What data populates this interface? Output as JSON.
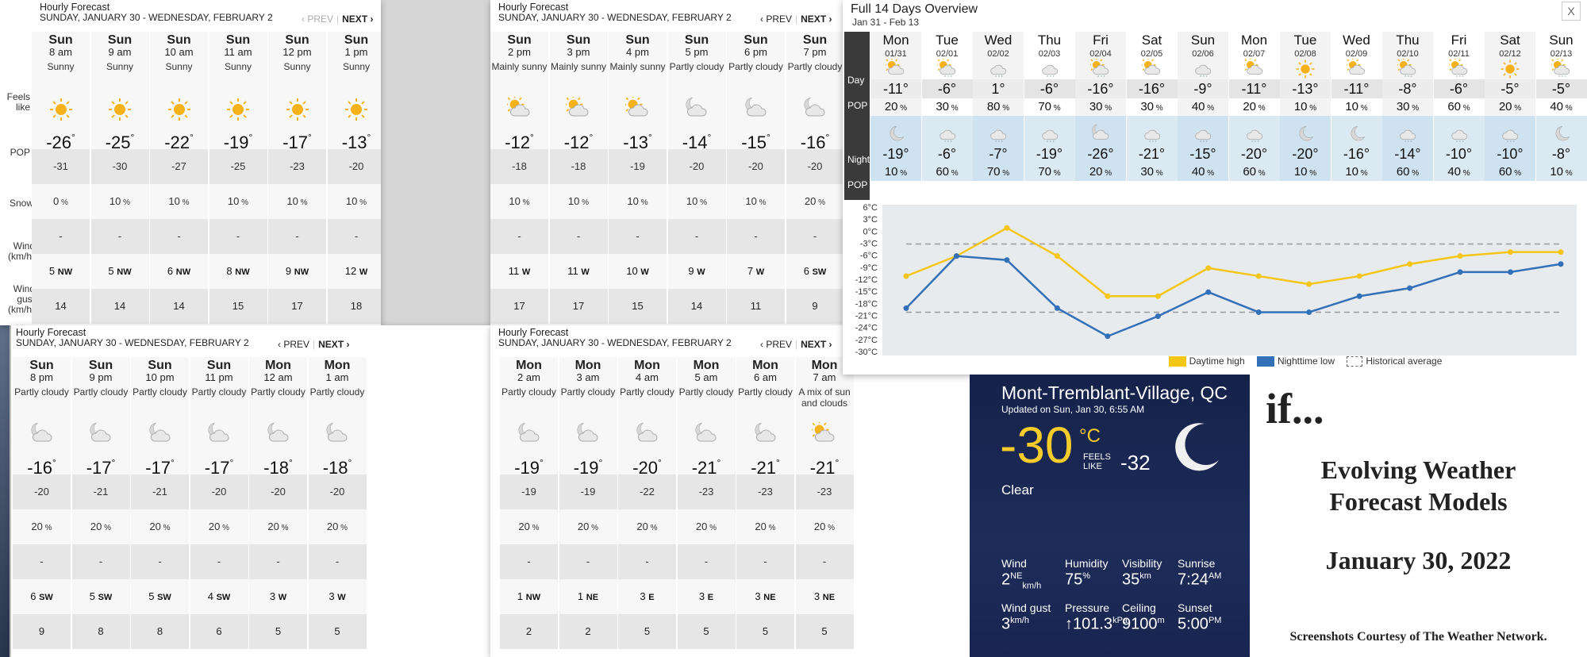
{
  "panels": [
    {
      "heading": "Hourly Forecast",
      "daterange": "SUNDAY, JANUARY 30 - WEDNESDAY, FEBRUARY 2",
      "prev": "‹ PREV",
      "next": "NEXT ›",
      "prev_active": false,
      "row_labels": {
        "feels": "Feels like",
        "pop": "POP",
        "snow": "Snow",
        "wind": "Wind (km/h)",
        "gust": "Wind gust (km/h)"
      },
      "hours": [
        {
          "day": "Sun",
          "time": "8 am",
          "cond": "Sunny",
          "icon": "sun",
          "temp": "-26",
          "feels": "-31",
          "pop": "0",
          "snow": "-",
          "wind": "5",
          "dir": "NW",
          "gust": "14"
        },
        {
          "day": "Sun",
          "time": "9 am",
          "cond": "Sunny",
          "icon": "sun",
          "temp": "-25",
          "feels": "-30",
          "pop": "10",
          "snow": "-",
          "wind": "5",
          "dir": "NW",
          "gust": "14"
        },
        {
          "day": "Sun",
          "time": "10 am",
          "cond": "Sunny",
          "icon": "sun",
          "temp": "-22",
          "feels": "-27",
          "pop": "10",
          "snow": "-",
          "wind": "6",
          "dir": "NW",
          "gust": "14"
        },
        {
          "day": "Sun",
          "time": "11 am",
          "cond": "Sunny",
          "icon": "sun",
          "temp": "-19",
          "feels": "-25",
          "pop": "10",
          "snow": "-",
          "wind": "8",
          "dir": "NW",
          "gust": "15"
        },
        {
          "day": "Sun",
          "time": "12 pm",
          "cond": "Sunny",
          "icon": "sun",
          "temp": "-17",
          "feels": "-23",
          "pop": "10",
          "snow": "-",
          "wind": "9",
          "dir": "NW",
          "gust": "17"
        },
        {
          "day": "Sun",
          "time": "1 pm",
          "cond": "Sunny",
          "icon": "sun",
          "temp": "-13",
          "feels": "-20",
          "pop": "10",
          "snow": "-",
          "wind": "12",
          "dir": "W",
          "gust": "18"
        }
      ]
    },
    {
      "heading": "Hourly Forecast",
      "daterange": "SUNDAY, JANUARY 30 - WEDNESDAY, FEBRUARY 2",
      "prev": "‹ PREV",
      "next": "NEXT ›",
      "prev_active": true,
      "hours": [
        {
          "day": "Sun",
          "time": "2 pm",
          "cond": "Mainly sunny",
          "icon": "sun-cloud",
          "temp": "-12",
          "feels": "-18",
          "pop": "10",
          "snow": "-",
          "wind": "11",
          "dir": "W",
          "gust": "17"
        },
        {
          "day": "Sun",
          "time": "3 pm",
          "cond": "Mainly sunny",
          "icon": "sun-cloud",
          "temp": "-12",
          "feels": "-18",
          "pop": "10",
          "snow": "-",
          "wind": "11",
          "dir": "W",
          "gust": "17"
        },
        {
          "day": "Sun",
          "time": "4 pm",
          "cond": "Mainly sunny",
          "icon": "sun-cloud",
          "temp": "-13",
          "feels": "-19",
          "pop": "10",
          "snow": "-",
          "wind": "10",
          "dir": "W",
          "gust": "15"
        },
        {
          "day": "Sun",
          "time": "5 pm",
          "cond": "Partly cloudy",
          "icon": "moon-cloud",
          "temp": "-14",
          "feels": "-20",
          "pop": "10",
          "snow": "-",
          "wind": "9",
          "dir": "W",
          "gust": "14"
        },
        {
          "day": "Sun",
          "time": "6 pm",
          "cond": "Partly cloudy",
          "icon": "moon-cloud",
          "temp": "-15",
          "feels": "-20",
          "pop": "10",
          "snow": "-",
          "wind": "7",
          "dir": "W",
          "gust": "11"
        },
        {
          "day": "Sun",
          "time": "7 pm",
          "cond": "Partly cloudy",
          "icon": "moon-cloud",
          "temp": "-16",
          "feels": "-20",
          "pop": "20",
          "snow": "-",
          "wind": "6",
          "dir": "SW",
          "gust": "9"
        }
      ]
    },
    {
      "heading": "Hourly Forecast",
      "daterange": "SUNDAY, JANUARY 30 - WEDNESDAY, FEBRUARY 2",
      "prev": "‹ PREV",
      "next": "NEXT ›",
      "prev_active": true,
      "hours": [
        {
          "day": "Sun",
          "time": "8 pm",
          "cond": "Partly cloudy",
          "icon": "moon-cloud",
          "temp": "-16",
          "feels": "-20",
          "pop": "20",
          "snow": "-",
          "wind": "6",
          "dir": "SW",
          "gust": "9"
        },
        {
          "day": "Sun",
          "time": "9 pm",
          "cond": "Partly cloudy",
          "icon": "moon-cloud",
          "temp": "-17",
          "feels": "-21",
          "pop": "20",
          "snow": "-",
          "wind": "5",
          "dir": "SW",
          "gust": "8"
        },
        {
          "day": "Sun",
          "time": "10 pm",
          "cond": "Partly cloudy",
          "icon": "moon-cloud",
          "temp": "-17",
          "feels": "-21",
          "pop": "20",
          "snow": "-",
          "wind": "5",
          "dir": "SW",
          "gust": "8"
        },
        {
          "day": "Sun",
          "time": "11 pm",
          "cond": "Partly cloudy",
          "icon": "moon-cloud",
          "temp": "-17",
          "feels": "-20",
          "pop": "20",
          "snow": "-",
          "wind": "4",
          "dir": "SW",
          "gust": "6"
        },
        {
          "day": "Mon",
          "time": "12 am",
          "cond": "Partly cloudy",
          "icon": "moon-cloud",
          "temp": "-18",
          "feels": "-20",
          "pop": "20",
          "snow": "-",
          "wind": "3",
          "dir": "W",
          "gust": "5"
        },
        {
          "day": "Mon",
          "time": "1 am",
          "cond": "Partly cloudy",
          "icon": "moon-cloud",
          "temp": "-18",
          "feels": "-20",
          "pop": "20",
          "snow": "-",
          "wind": "3",
          "dir": "W",
          "gust": "5"
        }
      ]
    },
    {
      "heading": "Hourly Forecast",
      "daterange": "SUNDAY, JANUARY 30 - WEDNESDAY, FEBRUARY 2",
      "prev": "‹ PREV",
      "next": "NEXT ›",
      "prev_active": true,
      "hours": [
        {
          "day": "Mon",
          "time": "2 am",
          "cond": "Partly cloudy",
          "icon": "moon-cloud",
          "temp": "-19",
          "feels": "-19",
          "pop": "20",
          "snow": "-",
          "wind": "1",
          "dir": "NW",
          "gust": "2"
        },
        {
          "day": "Mon",
          "time": "3 am",
          "cond": "Partly cloudy",
          "icon": "moon-cloud",
          "temp": "-19",
          "feels": "-19",
          "pop": "20",
          "snow": "-",
          "wind": "1",
          "dir": "NE",
          "gust": "2"
        },
        {
          "day": "Mon",
          "time": "4 am",
          "cond": "Partly cloudy",
          "icon": "moon-cloud",
          "temp": "-20",
          "feels": "-22",
          "pop": "20",
          "snow": "-",
          "wind": "3",
          "dir": "E",
          "gust": "5"
        },
        {
          "day": "Mon",
          "time": "5 am",
          "cond": "Partly cloudy",
          "icon": "moon-cloud",
          "temp": "-21",
          "feels": "-23",
          "pop": "20",
          "snow": "-",
          "wind": "3",
          "dir": "E",
          "gust": "5"
        },
        {
          "day": "Mon",
          "time": "6 am",
          "cond": "Partly cloudy",
          "icon": "moon-cloud",
          "temp": "-21",
          "feels": "-23",
          "pop": "20",
          "snow": "-",
          "wind": "3",
          "dir": "NE",
          "gust": "5"
        },
        {
          "day": "Mon",
          "time": "7 am",
          "cond": "A mix of sun and clouds",
          "icon": "sun-cloud",
          "temp": "-21",
          "feels": "-23",
          "pop": "20",
          "snow": "-",
          "wind": "3",
          "dir": "NE",
          "gust": "5"
        }
      ]
    }
  ],
  "overview": {
    "title": "Full 14 Days Overview",
    "range": "Jan 31 - Feb 13",
    "close": "X",
    "labels": {
      "day": "Day",
      "pop": "POP",
      "night": "Night",
      "npop": "POP"
    },
    "days": [
      {
        "dow": "Mon",
        "date": "01/31",
        "hi": "-11",
        "hpop": "20",
        "lo": "-19",
        "lpop": "10",
        "dicon": "sun-cloud",
        "nicon": "moon"
      },
      {
        "dow": "Tue",
        "date": "02/01",
        "hi": "-6",
        "hpop": "30",
        "lo": "-6",
        "lpop": "60",
        "dicon": "sun-snow",
        "nicon": "snow-cloud"
      },
      {
        "dow": "Wed",
        "date": "02/02",
        "hi": "1",
        "hpop": "80",
        "lo": "-7",
        "lpop": "70",
        "dicon": "snow-cloud",
        "nicon": "snow-cloud"
      },
      {
        "dow": "Thu",
        "date": "02/03",
        "hi": "-6",
        "hpop": "70",
        "lo": "-19",
        "lpop": "70",
        "dicon": "snow-cloud",
        "nicon": "snow-cloud"
      },
      {
        "dow": "Fri",
        "date": "02/04",
        "hi": "-16",
        "hpop": "30",
        "lo": "-26",
        "lpop": "20",
        "dicon": "sun-snow",
        "nicon": "moon-cloud"
      },
      {
        "dow": "Sat",
        "date": "02/05",
        "hi": "-16",
        "hpop": "30",
        "lo": "-21",
        "lpop": "30",
        "dicon": "sun-cloud",
        "nicon": "snow-cloud"
      },
      {
        "dow": "Sun",
        "date": "02/06",
        "hi": "-9",
        "hpop": "40",
        "lo": "-15",
        "lpop": "40",
        "dicon": "snow-cloud",
        "nicon": "snow-cloud"
      },
      {
        "dow": "Mon",
        "date": "02/07",
        "hi": "-11",
        "hpop": "20",
        "lo": "-20",
        "lpop": "60",
        "dicon": "sun-cloud",
        "nicon": "snow-cloud"
      },
      {
        "dow": "Tue",
        "date": "02/08",
        "hi": "-13",
        "hpop": "10",
        "lo": "-20",
        "lpop": "10",
        "dicon": "sun",
        "nicon": "moon"
      },
      {
        "dow": "Wed",
        "date": "02/09",
        "hi": "-11",
        "hpop": "10",
        "lo": "-16",
        "lpop": "10",
        "dicon": "sun-cloud",
        "nicon": "moon"
      },
      {
        "dow": "Thu",
        "date": "02/10",
        "hi": "-8",
        "hpop": "30",
        "lo": "-14",
        "lpop": "60",
        "dicon": "sun-snow",
        "nicon": "snow-cloud"
      },
      {
        "dow": "Fri",
        "date": "02/11",
        "hi": "-6",
        "hpop": "60",
        "lo": "-10",
        "lpop": "40",
        "dicon": "sun-snow",
        "nicon": "snow-cloud"
      },
      {
        "dow": "Sat",
        "date": "02/12",
        "hi": "-5",
        "hpop": "20",
        "lo": "-10",
        "lpop": "60",
        "dicon": "sun",
        "nicon": "snow-cloud"
      },
      {
        "dow": "Sun",
        "date": "02/13",
        "hi": "-5",
        "hpop": "40",
        "lo": "-8",
        "lpop": "10",
        "dicon": "sun-snow",
        "nicon": "moon"
      }
    ],
    "legend": {
      "high": "Daytime high",
      "low": "Nighttime low",
      "avg": "Historical average"
    }
  },
  "chart_data": {
    "type": "line",
    "x": [
      "01/31",
      "02/01",
      "02/02",
      "02/03",
      "02/04",
      "02/05",
      "02/06",
      "02/07",
      "02/08",
      "02/09",
      "02/10",
      "02/11",
      "02/12",
      "02/13"
    ],
    "series": [
      {
        "name": "Daytime high",
        "color": "#f5c518",
        "values": [
          -11,
          -6,
          1,
          -6,
          -16,
          -16,
          -9,
          -11,
          -13,
          -11,
          -8,
          -6,
          -5,
          -5
        ]
      },
      {
        "name": "Nighttime low",
        "color": "#3270b8",
        "values": [
          -19,
          -6,
          -7,
          -19,
          -26,
          -21,
          -15,
          -20,
          -20,
          -16,
          -14,
          -10,
          -10,
          -8
        ]
      },
      {
        "name": "Historical average",
        "values": [
          -3,
          -20
        ]
      }
    ],
    "yticks": [
      "6°C",
      "3°C",
      "0°C",
      "-3°C",
      "-6°C",
      "-9°C",
      "-12°C",
      "-15°C",
      "-18°C",
      "-21°C",
      "-24°C",
      "-27°C",
      "-30°C"
    ],
    "ylim": [
      -30,
      6
    ],
    "grid": false,
    "legend_position": "bottom"
  },
  "current": {
    "location": "Mont-Tremblant-Village, QC",
    "updated": "Updated on Sun, Jan 30, 6:55 AM",
    "temp": "-30",
    "unit": "°C",
    "feels_label": "FEELS LIKE",
    "feels": "-32",
    "condition": "Clear",
    "stats": [
      {
        "label": "Wind",
        "value": "2",
        "sup": "NE",
        "sub": "km/h"
      },
      {
        "label": "Humidity",
        "value": "75",
        "sup": "%",
        "sub": ""
      },
      {
        "label": "Visibility",
        "value": "35",
        "sup": "km",
        "sub": ""
      },
      {
        "label": "Sunrise",
        "value": "7:24",
        "sup": "AM",
        "sub": ""
      },
      {
        "label": "Wind gust",
        "value": "3",
        "sup": "km/h",
        "sub": ""
      },
      {
        "label": "Pressure",
        "value": "↑101.3",
        "sup": "kPa",
        "sub": ""
      },
      {
        "label": "Ceiling",
        "value": "9100",
        "sup": "m",
        "sub": ""
      },
      {
        "label": "Sunset",
        "value": "5:00",
        "sup": "PM",
        "sub": ""
      }
    ]
  },
  "title_card": {
    "if": "if...",
    "line1": "Evolving Weather",
    "line2": "Forecast Models",
    "date": "January 30, 2022",
    "credit": "Screenshots Courtesy of The Weather Network."
  },
  "colors": {
    "high": "#f5c518",
    "low": "#3270b8",
    "current_temp": "#f6cc2b",
    "night_row": "#cfe2ef"
  }
}
